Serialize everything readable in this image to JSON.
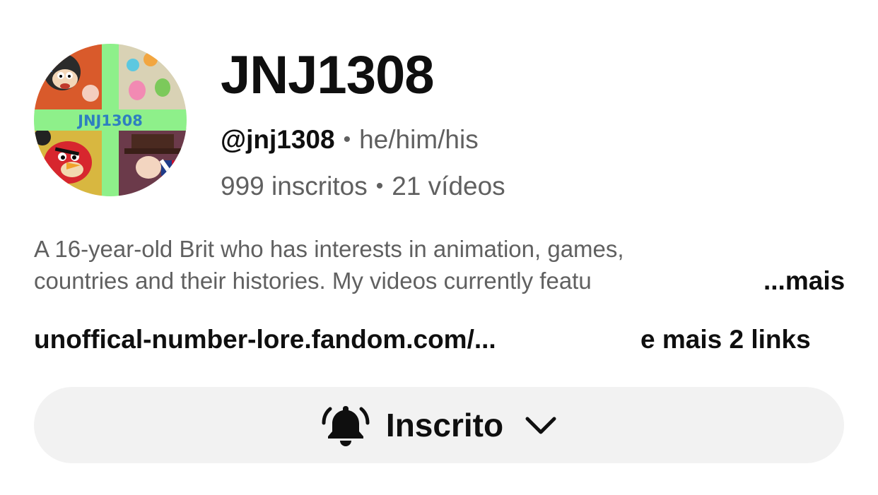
{
  "channel": {
    "name": "JNJ1308",
    "handle": "@jnj1308",
    "pronouns": "he/him/his",
    "subscribers": "999 inscritos",
    "videos": "21 vídeos",
    "avatar_text": "JNJ1308"
  },
  "description": {
    "line1": "A 16-year-old Brit who has interests in animation, games,",
    "line2": "countries and their histories. My videos currently featu",
    "more_label": "...mais"
  },
  "links": {
    "primary": "unoffical-number-lore.fandom.com/...",
    "extra": "e mais 2 links"
  },
  "subscribe_button": {
    "label": "Inscrito",
    "icon": "bell-ring-icon",
    "dropdown_icon": "chevron-down-icon"
  }
}
